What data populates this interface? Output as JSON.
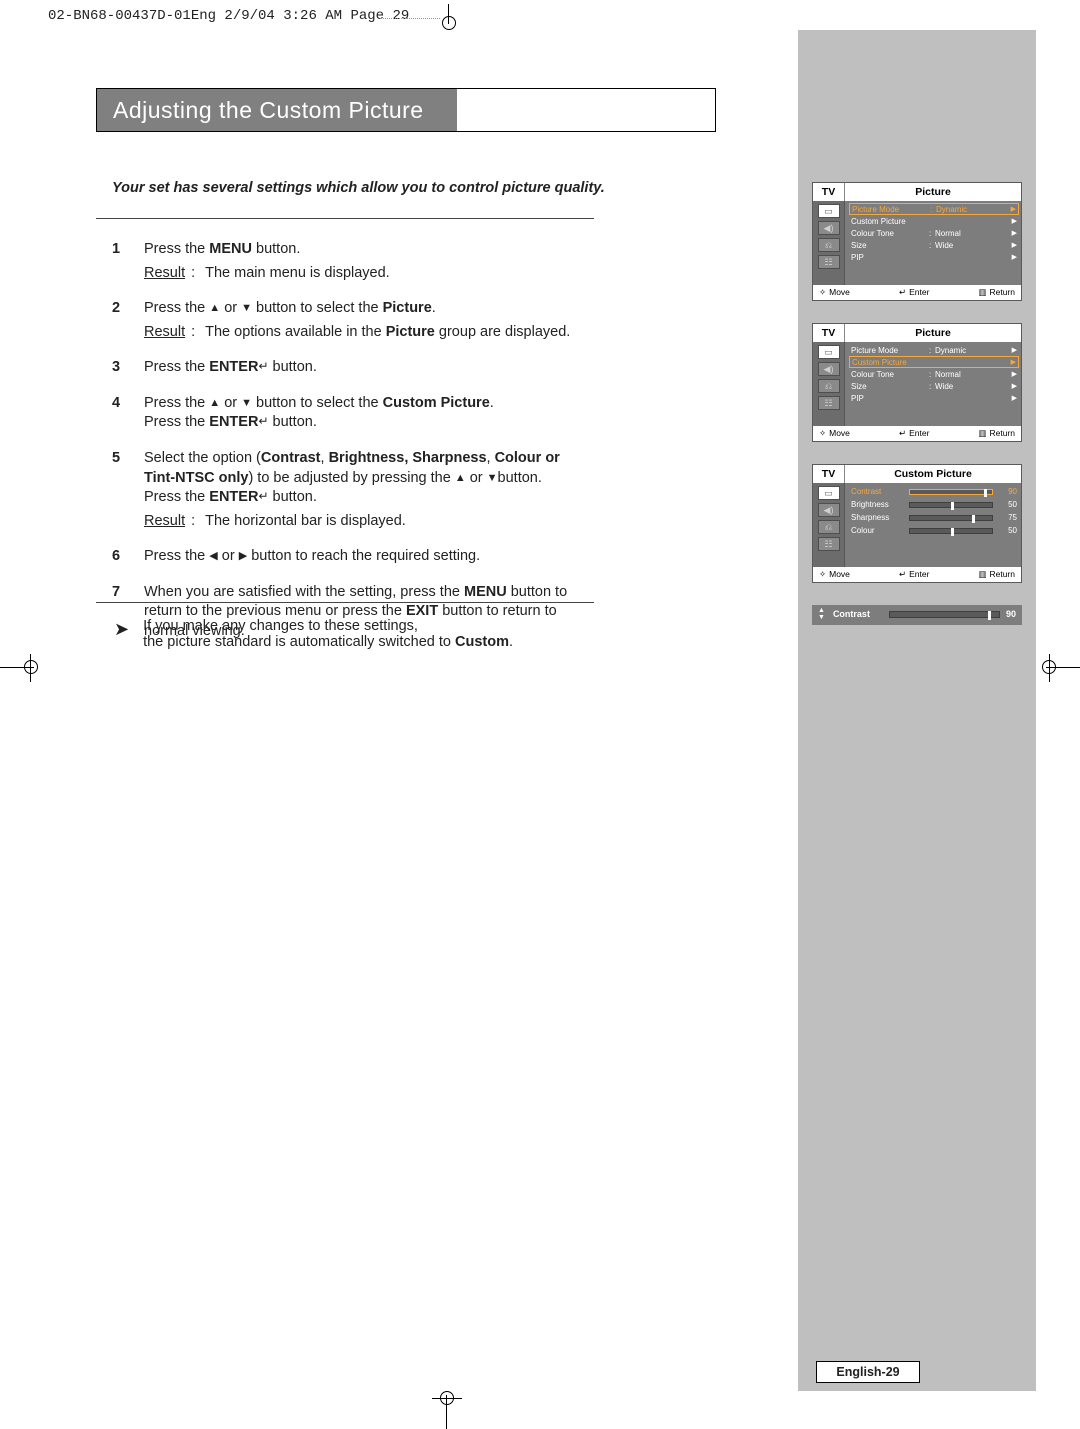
{
  "print_header": "02-BN68-00437D-01Eng  2/9/04  3:26 AM  Page 29",
  "page_title": "Adjusting the Custom Picture",
  "intro": "Your set has several settings which allow you to control picture quality.",
  "steps": [
    {
      "num": "1",
      "text_a": "Press the ",
      "bold_a": "MENU",
      "text_b": " button.",
      "result": "The main menu is displayed."
    },
    {
      "num": "2",
      "text_a": "Press the ",
      "tri_up": "▲",
      "mid": " or ",
      "tri_dn": "▼",
      "text_b": " button to select the ",
      "bold_a": "Picture",
      "tail": ".",
      "result_pre": "The options available in the ",
      "result_bold": "Picture",
      "result_post": " group are displayed."
    },
    {
      "num": "3",
      "text_a": "Press the ",
      "bold_a": "ENTER",
      "icon": "↵",
      "text_b": " button."
    },
    {
      "num": "4",
      "text_a": "Press the ",
      "tri_up": "▲",
      "mid": " or ",
      "tri_dn": "▼",
      "text_b": " button to select the ",
      "bold_a": "Custom Picture",
      "tail": ".",
      "line2_a": "Press the ",
      "line2_bold": "ENTER",
      "line2_icon": "↵",
      "line2_b": " button."
    },
    {
      "num": "5",
      "text_a": "Select the option (",
      "bold_a": "Contrast",
      "text_b": ", ",
      "bold_b": "Brightness, Sharpness",
      "text_c": ", ",
      "bold_c": "Colour or Tint-NTSC only",
      "text_d": ") to be adjusted by pressing the ",
      "tri_up": "▲",
      "mid": " or ",
      "tri_dn": "▼",
      "tail": "button.",
      "line2_a": "Press the ",
      "line2_bold": "ENTER",
      "line2_icon": "↵",
      "line2_b": " button.",
      "result": "The horizontal bar is displayed."
    },
    {
      "num": "6",
      "text_a": "Press the ",
      "tri_l": "◀",
      "mid": " or ",
      "tri_r": "▶",
      "text_b": " button to reach the required setting."
    },
    {
      "num": "7",
      "text_a": "When you are satisfied with the setting, press the ",
      "bold_a": "MENU",
      "text_b": " button to return to the previous menu or press the ",
      "bold_b": "EXIT",
      "text_c": " button to return to normal viewing."
    }
  ],
  "note_line1": "If you make any changes to these settings,",
  "note_line2_a": "the picture standard is automatically switched to ",
  "note_line2_bold": "Custom",
  "note_line2_b": ".",
  "page_number": "English-29",
  "osd": {
    "tv_label": "TV",
    "foot_move": "Move",
    "foot_enter": "Enter",
    "foot_return": "Return",
    "panel1": {
      "title": "Picture",
      "rows": [
        {
          "label": "Picture Mode",
          "value": "Dynamic",
          "hl": true
        },
        {
          "label": "Custom Picture",
          "value": "",
          "hl": false
        },
        {
          "label": "Colour Tone",
          "value": "Normal",
          "hl": false
        },
        {
          "label": "Size",
          "value": "Wide",
          "hl": false
        },
        {
          "label": "PIP",
          "value": "",
          "hl": false
        }
      ]
    },
    "panel2": {
      "title": "Picture",
      "rows": [
        {
          "label": "Picture Mode",
          "value": "Dynamic",
          "hl": false
        },
        {
          "label": "Custom Picture",
          "value": "",
          "hl": true
        },
        {
          "label": "Colour Tone",
          "value": "Normal",
          "hl": false
        },
        {
          "label": "Size",
          "value": "Wide",
          "hl": false
        },
        {
          "label": "PIP",
          "value": "",
          "hl": false
        }
      ]
    },
    "panel3": {
      "title": "Custom Picture",
      "sliders": [
        {
          "label": "Contrast",
          "value": 90,
          "hl": true
        },
        {
          "label": "Brightness",
          "value": 50,
          "hl": false
        },
        {
          "label": "Sharpness",
          "value": 75,
          "hl": false
        },
        {
          "label": "Colour",
          "value": 50,
          "hl": false
        }
      ]
    },
    "contrast_bar": {
      "label": "Contrast",
      "value": 90
    }
  },
  "result_label": "Result"
}
